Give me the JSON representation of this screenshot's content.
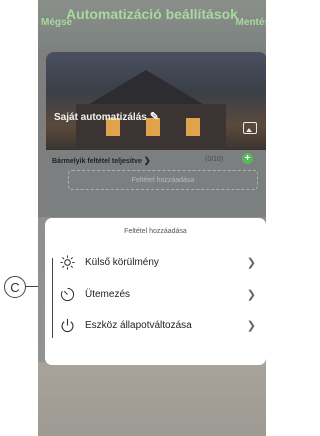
{
  "header": {
    "cancel_label": "Mégse",
    "title": "Automatizáció beállítások",
    "save_label": "Mentés"
  },
  "card": {
    "name_label": "Saját automatizálás",
    "condition_label": "Bármelyik feltétel teljesítve",
    "condition_count": "(0/10)",
    "add_condition_label": "Feltétel hozzáadása"
  },
  "sheet": {
    "title": "Feltétel hozzáadása",
    "items": [
      {
        "label": "Külső körülmény",
        "icon": "sun-icon"
      },
      {
        "label": "Ütemezés",
        "icon": "timer-icon"
      },
      {
        "label": "Eszköz állapotváltozása",
        "icon": "power-icon"
      }
    ]
  },
  "callout": {
    "label": "C"
  }
}
